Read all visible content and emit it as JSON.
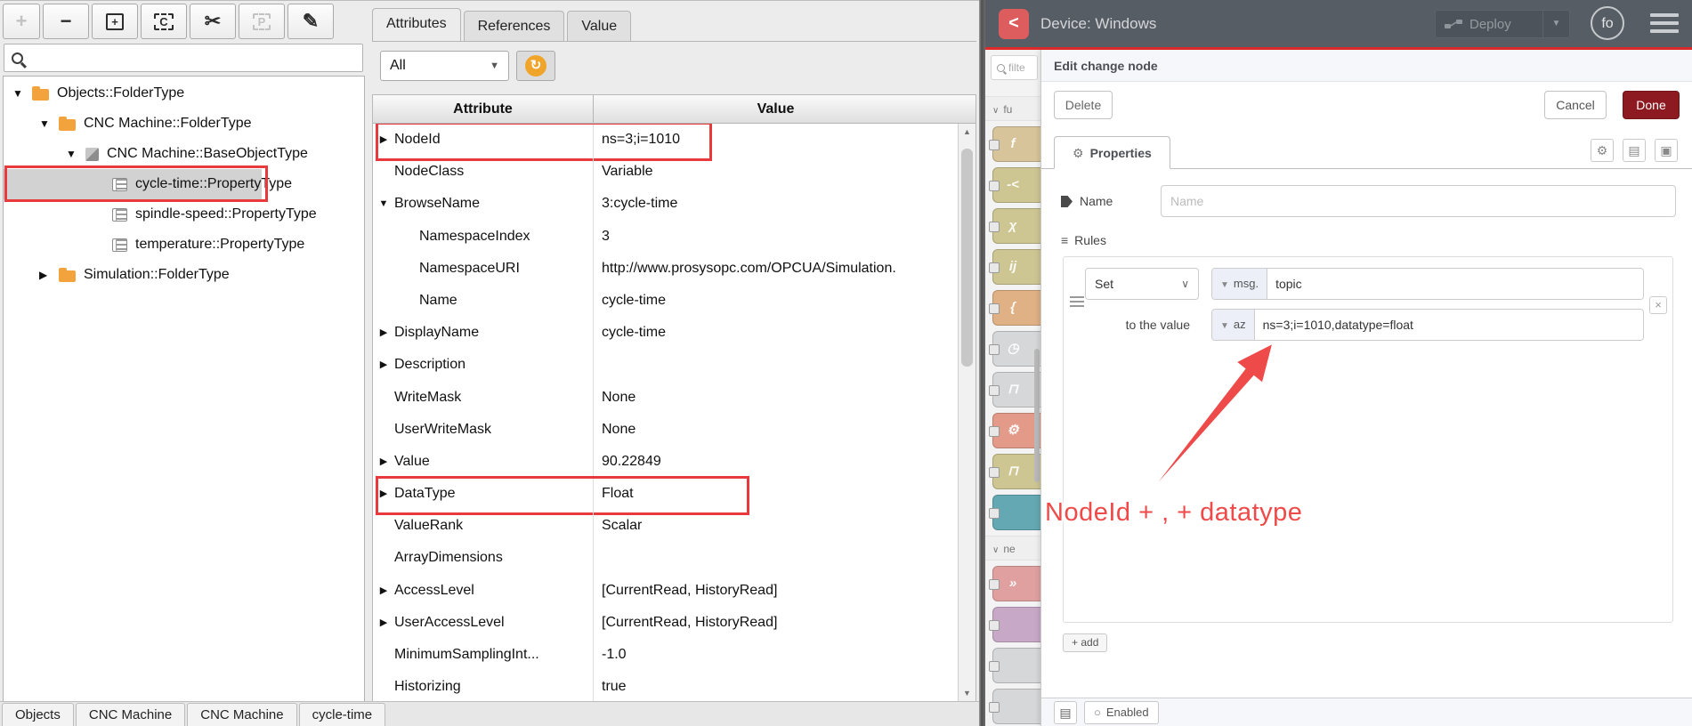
{
  "colors": {
    "accent_red": "#e8393d",
    "annotation_red": "#ed4a49",
    "folder_orange": "#f2a33c",
    "done_red": "#8c1a20",
    "header_dark": "#575d64",
    "header_accent_line": "#e02a2a",
    "refresh_orange": "#f0a52a"
  },
  "left_app": {
    "toolbar": {
      "buttons": [
        {
          "name": "add-node-button",
          "glyph": "+",
          "disabled": true
        },
        {
          "name": "remove-node-button",
          "glyph": "−"
        },
        {
          "name": "new-object-button",
          "glyph": "+",
          "frame": "solid"
        },
        {
          "name": "copy-button",
          "glyph": "C",
          "frame": "dashed"
        },
        {
          "name": "cut-button",
          "glyph": "✂"
        },
        {
          "name": "paste-button",
          "glyph": "P",
          "frame": "dashed",
          "disabled": true
        },
        {
          "name": "edit-button",
          "glyph": "✎"
        }
      ]
    },
    "search": {
      "value": ""
    },
    "tree": {
      "items": [
        {
          "label": "Objects::FolderType",
          "level": 0,
          "expander": "open",
          "icon": "folder"
        },
        {
          "label": "CNC Machine::FolderType",
          "level": 1,
          "expander": "open",
          "icon": "folder"
        },
        {
          "label": "CNC Machine::BaseObjectType",
          "level": 2,
          "expander": "open",
          "icon": "cube"
        },
        {
          "label": "cycle-time::PropertyType",
          "level": 3,
          "expander": "none",
          "icon": "property",
          "selected": true,
          "annotated": true
        },
        {
          "label": "spindle-speed::PropertyType",
          "level": 3,
          "expander": "none",
          "icon": "property"
        },
        {
          "label": "temperature::PropertyType",
          "level": 3,
          "expander": "none",
          "icon": "property"
        },
        {
          "label": "Simulation::FolderType",
          "level": 1,
          "expander": "closed",
          "icon": "folder"
        }
      ]
    },
    "attributes_panel": {
      "tabs": [
        {
          "label": "Attributes",
          "active": true
        },
        {
          "label": "References",
          "active": false
        },
        {
          "label": "Value",
          "active": false
        }
      ],
      "filter_value": "All",
      "columns": [
        "Attribute",
        "Value"
      ],
      "rows": [
        {
          "arrow": "r",
          "label": "NodeId",
          "value": "ns=3;i=1010",
          "hl": "nodeid"
        },
        {
          "label": "NodeClass",
          "value": "Variable"
        },
        {
          "arrow": "d",
          "label": "BrowseName",
          "value": "3:cycle-time"
        },
        {
          "indent": 1,
          "label": "NamespaceIndex",
          "value": "3"
        },
        {
          "indent": 1,
          "label": "NamespaceURI",
          "value": "http://www.prosysopc.com/OPCUA/Simulation."
        },
        {
          "indent": 1,
          "label": "Name",
          "value": "cycle-time"
        },
        {
          "arrow": "r",
          "label": "DisplayName",
          "value": "cycle-time"
        },
        {
          "arrow": "r",
          "label": "Description",
          "value": ""
        },
        {
          "label": "WriteMask",
          "value": "None"
        },
        {
          "label": "UserWriteMask",
          "value": "None"
        },
        {
          "arrow": "r",
          "label": "Value",
          "value": "90.22849"
        },
        {
          "arrow": "r",
          "label": "DataType",
          "value": "Float",
          "hl": "datatype"
        },
        {
          "label": "ValueRank",
          "value": "Scalar"
        },
        {
          "label": "ArrayDimensions",
          "value": ""
        },
        {
          "arrow": "r",
          "label": "AccessLevel",
          "value": "[CurrentRead, HistoryRead]"
        },
        {
          "arrow": "r",
          "label": "UserAccessLevel",
          "value": "[CurrentRead, HistoryRead]"
        },
        {
          "label": "MinimumSamplingInt...",
          "value": "-1.0"
        },
        {
          "label": "Historizing",
          "value": "true"
        }
      ]
    },
    "bottom_tabs": [
      "Objects",
      "CNC Machine",
      "CNC Machine",
      "cycle-time"
    ]
  },
  "node_red": {
    "header": {
      "title": "Device: Windows",
      "deploy_label": "Deploy",
      "avatar_label": "fo"
    },
    "palette": {
      "search_text": "filte",
      "items": [
        {
          "type": "category",
          "label": "fu"
        },
        {
          "type": "node",
          "color": "#d7c49a",
          "glyph": "f"
        },
        {
          "type": "node",
          "color": "#cdc592",
          "glyph": "-<"
        },
        {
          "type": "node",
          "color": "#cdc592",
          "glyph": "χ"
        },
        {
          "type": "node",
          "color": "#cdc592",
          "glyph": "ij"
        },
        {
          "type": "node",
          "color": "#dfb184",
          "glyph": "{"
        },
        {
          "type": "node",
          "color": "#d6d7d9",
          "glyph": "◷"
        },
        {
          "type": "node",
          "color": "#d6d7d9",
          "glyph": "⊓"
        },
        {
          "type": "node",
          "color": "#e39a88",
          "glyph": "⚙"
        },
        {
          "type": "node",
          "color": "#cdc592",
          "glyph": "⊓"
        },
        {
          "type": "node",
          "color": "#63a8b2",
          "glyph": ""
        },
        {
          "type": "category",
          "label": "ne"
        },
        {
          "type": "node",
          "color": "#e0a0a0",
          "glyph": "»"
        },
        {
          "type": "node",
          "color": "#c7a8c7",
          "glyph": ""
        },
        {
          "type": "node",
          "color": "#d6d7d9",
          "glyph": ""
        },
        {
          "type": "node",
          "color": "#d6d7d9",
          "glyph": ""
        }
      ]
    },
    "tray": {
      "title": "Edit change node",
      "delete_label": "Delete",
      "cancel_label": "Cancel",
      "done_label": "Done",
      "properties_tab_label": "Properties",
      "name_label": "Name",
      "name_placeholder": "Name",
      "rules_label": "Rules",
      "rule": {
        "action": "Set",
        "property_prefix": "msg.",
        "property_value": "topic",
        "to_label": "to the value",
        "value_type": "az",
        "value": "ns=3;i=1010,datatype=float"
      },
      "add_label": "+ add",
      "enabled_label": "Enabled"
    },
    "annotation": {
      "text": "NodeId + , + datatype"
    }
  }
}
